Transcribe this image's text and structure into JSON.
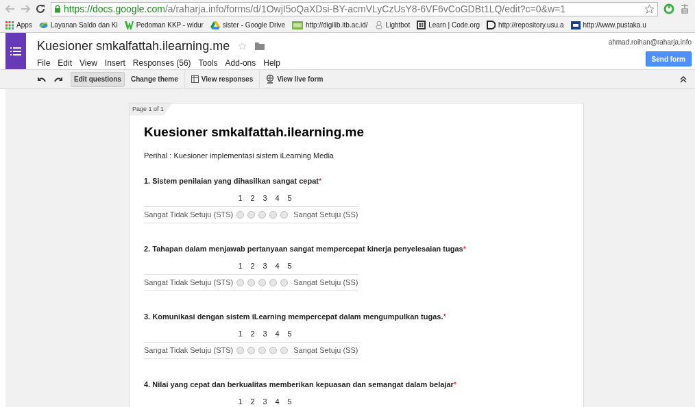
{
  "browser": {
    "url_host": "https://docs.google.com",
    "url_path": "/a/raharja.info/forms/d/1OwjI5oQaXDsi-BY-acmVLyCzUsY8-6VF6vCoGDBt1LQ/edit?c=0&w=1",
    "bookmarks": [
      {
        "label": "Apps",
        "kind": "apps"
      },
      {
        "label": "Layanan Saldo dan Ki",
        "kind": "leaf"
      },
      {
        "label": "Pedoman KKP - widur",
        "kind": "w"
      },
      {
        "label": "sister - Google Drive",
        "kind": "drive"
      },
      {
        "label": "http://digilib.itb.ac.id/",
        "kind": "gdl"
      },
      {
        "label": "Lightbot",
        "kind": "robot"
      },
      {
        "label": "Learn | Code.org",
        "kind": "code"
      },
      {
        "label": "http://repository.usu.a",
        "kind": "d"
      },
      {
        "label": "http://www.pustaka.u",
        "kind": "ut"
      }
    ]
  },
  "app": {
    "title": "Kuesioner smkalfattah.ilearning.me",
    "user": "ahmad.roihan@raharja.info",
    "send_button": "Send form",
    "menu": [
      "File",
      "Edit",
      "View",
      "Insert",
      "Responses (56)",
      "Tools",
      "Add-ons",
      "Help"
    ],
    "toolbar": [
      {
        "label": "Edit questions",
        "selected": true
      },
      {
        "label": "Change theme",
        "selected": false
      },
      {
        "label": "View responses",
        "selected": false
      },
      {
        "label": "View live form",
        "selected": false
      }
    ]
  },
  "form": {
    "page_label": "Page 1 of 1",
    "title": "Kuesioner smkalfattah.ilearning.me",
    "description": "Perihal : Kuesioner implementasi sistem iLearning Media",
    "questions": [
      {
        "title": "1. Sistem penilaian yang dihasilkan sangat cepat",
        "required_mark": "*",
        "scale": [
          "1",
          "2",
          "3",
          "4",
          "5"
        ],
        "low": "Sangat Tidak Setuju (STS)",
        "high": "Sangat Setuju (SS)",
        "choices": [
          {
            "selected": false
          },
          {
            "selected": false
          },
          {
            "selected": false
          },
          {
            "selected": false
          },
          {
            "selected": false
          }
        ]
      },
      {
        "title": "2. Tahapan dalam menjawab pertanyaan sangat mempercepat kinerja penyelesaian tugas",
        "required_mark": "*",
        "scale": [
          "1",
          "2",
          "3",
          "4",
          "5"
        ],
        "low": "Sangat Tidak Setuju (STS)",
        "high": "Sangat Setuju (SS)",
        "choices": [
          {
            "selected": false
          },
          {
            "selected": false
          },
          {
            "selected": false
          },
          {
            "selected": false
          },
          {
            "selected": false
          }
        ]
      },
      {
        "title": "3. Komunikasi dengan sistem iLearning mempercepat dalam mengumpulkan tugas.",
        "required_mark": "*",
        "scale": [
          "1",
          "2",
          "3",
          "4",
          "5"
        ],
        "low": "Sangat Tidak Setuju (STS)",
        "high": "Sangat Setuju (SS)",
        "choices": [
          {
            "selected": false
          },
          {
            "selected": false
          },
          {
            "selected": false
          },
          {
            "selected": false
          },
          {
            "selected": false
          }
        ]
      },
      {
        "title": "4. Nilai yang cepat dan berkualitas memberikan kepuasan dan semangat dalam belajar",
        "required_mark": "*",
        "scale": [
          "1",
          "2",
          "3",
          "4",
          "5"
        ]
      }
    ]
  }
}
